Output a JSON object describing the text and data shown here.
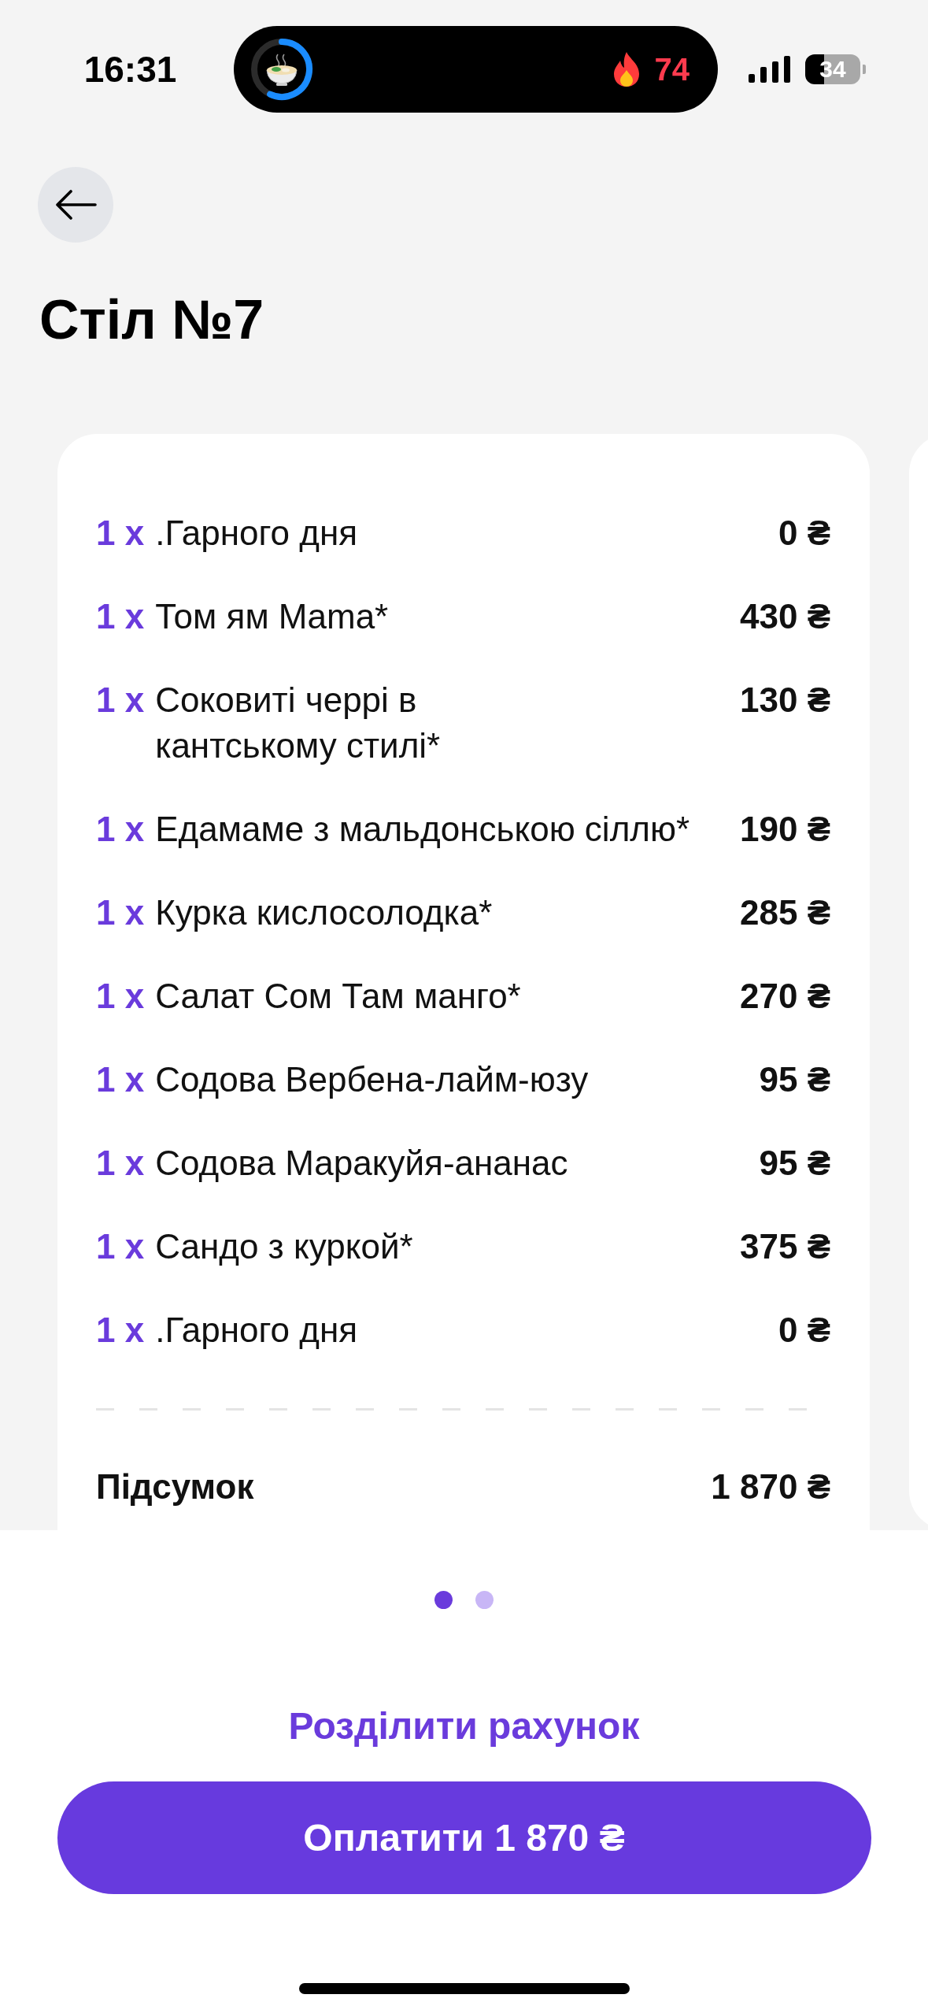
{
  "status_bar": {
    "time": "16:31",
    "live_activity": {
      "level": 0.57,
      "streak": "74"
    },
    "battery": "34"
  },
  "header": {
    "title": "Стіл №7"
  },
  "order": {
    "items": [
      {
        "quantity": "1 x",
        "name": ".Гарного дня",
        "price": "0 ₴"
      },
      {
        "quantity": "1 x",
        "name": "Том ям Mama*",
        "price": "430 ₴"
      },
      {
        "quantity": "1 x",
        "name": "Соковиті черрі в\nкантському стилі*",
        "price": "130 ₴"
      },
      {
        "quantity": "1 x",
        "name": "Едамаме з мальдонською сіллю*",
        "price": "190 ₴"
      },
      {
        "quantity": "1 x",
        "name": "Курка кислосолодка*",
        "price": "285 ₴"
      },
      {
        "quantity": "1 x",
        "name": "Салат Сом Там манго*",
        "price": "270 ₴"
      },
      {
        "quantity": "1 x",
        "name": "Содова Вербена-лайм-юзу",
        "price": "95 ₴"
      },
      {
        "quantity": "1 x",
        "name": "Содова Маракуйя-ананас",
        "price": "95 ₴"
      },
      {
        "quantity": "1 x",
        "name": "Сандо з куркой*",
        "price": "375 ₴"
      },
      {
        "quantity": "1 x",
        "name": ".Гарного дня",
        "price": "0 ₴"
      }
    ],
    "subtotal": {
      "label": "Підсумок",
      "value": "1 870 ₴"
    }
  },
  "pager": [
    {
      "selected": true
    },
    {
      "selected": false
    }
  ],
  "actions": {
    "split_link": "Розділити рахунок",
    "pay_button": "Оплатити 1 870 ₴"
  }
}
